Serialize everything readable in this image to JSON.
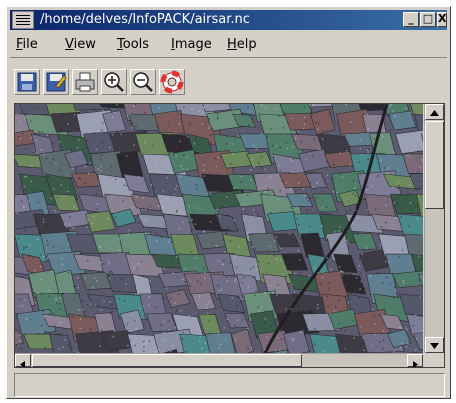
{
  "window": {
    "title": "/home/delves/InfoPACK/airsar.nc"
  },
  "title_buttons": {
    "minimize": "_",
    "maximize": "□",
    "close": "X"
  },
  "menubar": {
    "items": [
      "File",
      "View",
      "Tools",
      "Image",
      "Help"
    ]
  },
  "toolbar": {
    "icons": [
      "save-icon",
      "save-as-icon",
      "print-icon",
      "zoom-in-icon",
      "zoom-out-icon",
      "help-lifebuoy-icon"
    ]
  },
  "colors": {
    "titlebar_start": "#0a246a",
    "titlebar_end": "#3a6ea5",
    "chrome": "#d4d0c8"
  },
  "status": {
    "text": ""
  }
}
